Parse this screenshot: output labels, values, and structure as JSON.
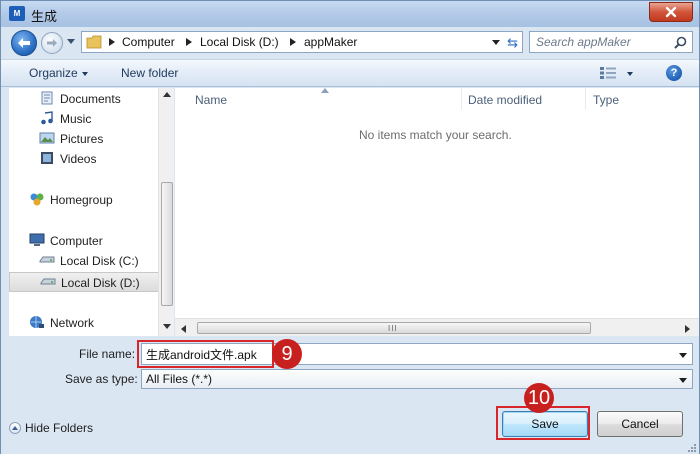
{
  "window": {
    "title": "生成",
    "app_icon_text": "M"
  },
  "address": {
    "crumbs": [
      "Computer",
      "Local Disk (D:)",
      "appMaker"
    ]
  },
  "search": {
    "placeholder": "Search appMaker"
  },
  "toolbar": {
    "organize_label": "Organize",
    "new_folder_label": "New folder"
  },
  "nav": {
    "items": [
      {
        "label": "Documents",
        "icon": "documents-icon"
      },
      {
        "label": "Music",
        "icon": "music-icon"
      },
      {
        "label": "Pictures",
        "icon": "pictures-icon"
      },
      {
        "label": "Videos",
        "icon": "videos-icon"
      },
      {
        "label": "Homegroup",
        "icon": "homegroup-icon"
      },
      {
        "label": "Computer",
        "icon": "computer-icon"
      },
      {
        "label": "Local Disk (C:)",
        "icon": "drive-icon"
      },
      {
        "label": "Local Disk (D:)",
        "icon": "drive-icon",
        "selected": true
      },
      {
        "label": "Network",
        "icon": "network-icon"
      }
    ]
  },
  "content": {
    "columns": [
      "Name",
      "Date modified",
      "Type"
    ],
    "empty_message": "No items match your search."
  },
  "fields": {
    "file_name_label": "File name:",
    "file_name_value": "生成android文件.apk",
    "save_type_label": "Save as type:",
    "save_type_value": "All Files (*.*)"
  },
  "footer": {
    "hide_folders_label": "Hide Folders",
    "save_label": "Save",
    "cancel_label": "Cancel"
  },
  "annotations": {
    "filename_step": "9",
    "save_step": "10",
    "color": "#d9262a"
  },
  "colors": {
    "window_bg": "#dbe6f3",
    "accent": "#1f5fb4"
  }
}
